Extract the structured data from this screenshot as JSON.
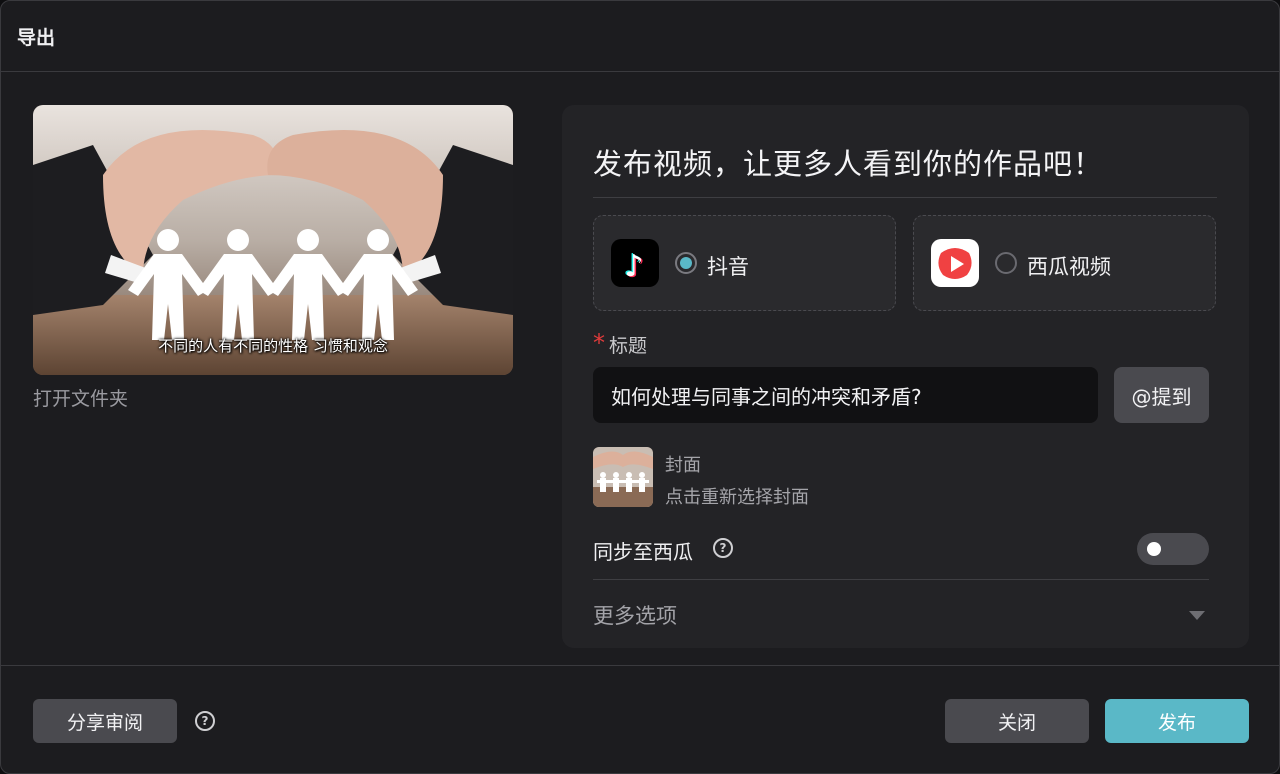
{
  "window": {
    "title": "导出"
  },
  "preview": {
    "subtitle": "不同的人有不同的性格 习惯和观念",
    "open_folder": "打开文件夹"
  },
  "publish": {
    "heading": "发布视频，让更多人看到你的作品吧！",
    "platforms": [
      {
        "name": "抖音",
        "selected": true,
        "icon": "douyin-logo-icon"
      },
      {
        "name": "西瓜视频",
        "selected": false,
        "icon": "xigua-logo-icon"
      }
    ],
    "title_required_mark": "*",
    "title_label": "标题",
    "title_value": "如何处理与同事之间的冲突和矛盾?",
    "mention_label": "@提到",
    "cover_label": "封面",
    "cover_hint": "点击重新选择封面",
    "sync_label": "同步至西瓜",
    "sync_enabled": false,
    "more_options": "更多选项"
  },
  "footer": {
    "share_review": "分享审阅",
    "close": "关闭",
    "publish": "发布"
  },
  "colors": {
    "accent": "#5ab8c7",
    "required": "#e23b3b",
    "background": "#1c1c1f",
    "panel": "#232326"
  }
}
